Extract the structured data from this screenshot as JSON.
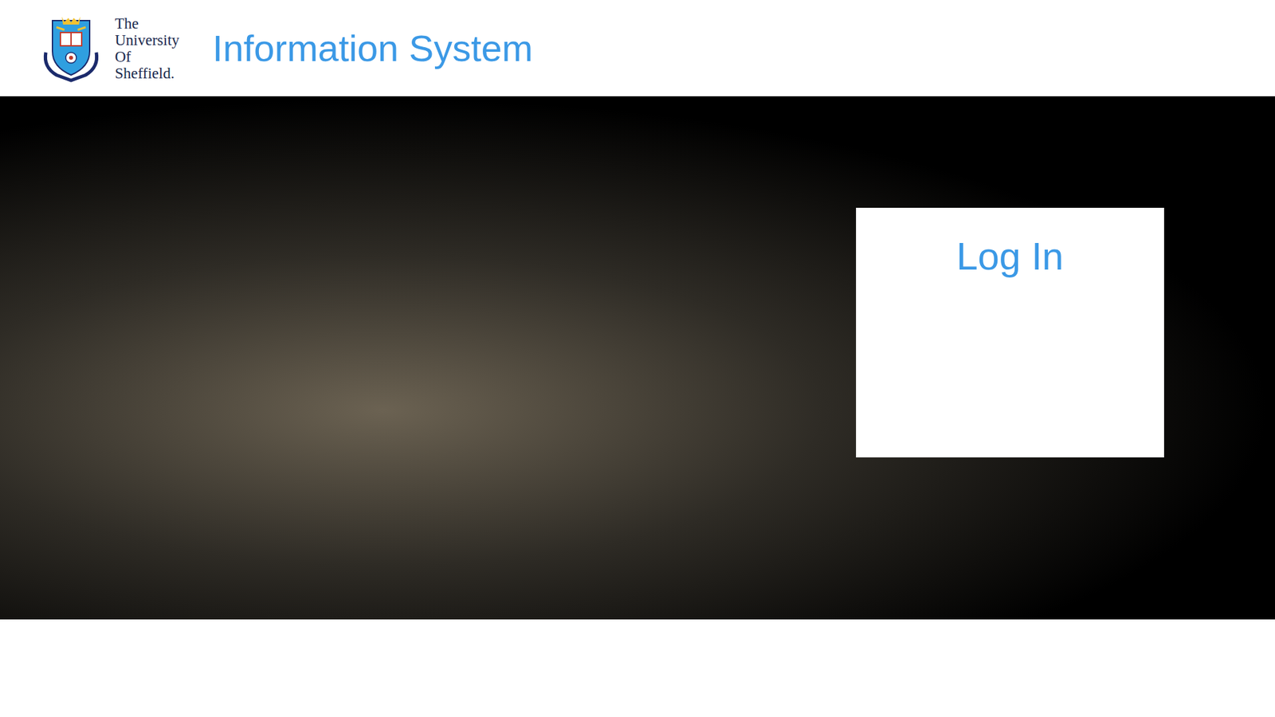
{
  "header": {
    "logo_text": [
      "The",
      "University",
      "Of",
      "Sheffield."
    ],
    "title": "Information System"
  },
  "login": {
    "title": "Log In"
  }
}
